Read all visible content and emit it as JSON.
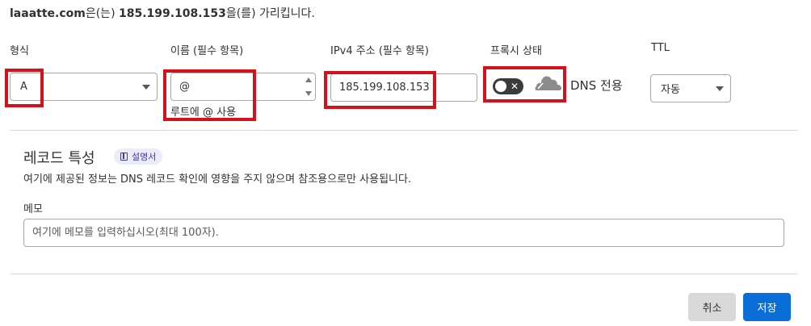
{
  "header": {
    "domain": "laaatte.com",
    "text_mid": "은(는) ",
    "ip": "185.199.108.153",
    "text_end": "을(를) 가리킵니다."
  },
  "columns": {
    "type_label": "형식",
    "name_label": "이름 (필수 항목)",
    "ipv4_label": "IPv4 주소 (필수 항목)",
    "proxy_label": "프록시 상태",
    "ttl_label": "TTL"
  },
  "type_select": {
    "value": "A"
  },
  "name_input": {
    "value": "@",
    "help": "루트에 @ 사용"
  },
  "ipv4_input": {
    "value": "185.199.108.153"
  },
  "proxy": {
    "toggle_on": false,
    "toggle_glyph": "✕",
    "status_text": "DNS 전용",
    "icon": "cloud-icon"
  },
  "ttl_select": {
    "value": "자동"
  },
  "record_attributes": {
    "title": "레코드 특성",
    "doc_badge": "설명서",
    "description": "여기에 제공된 정보는 DNS 레코드 확인에 영향을 주지 않으며 참조용으로만 사용됩니다.",
    "memo_label": "메모",
    "memo_placeholder": "여기에 메모를 입력하십시오(최대 100자)."
  },
  "actions": {
    "cancel_label": "취소",
    "save_label": "저장"
  },
  "colors": {
    "highlight": "#d4121b",
    "primary": "#0a6ed9",
    "badge_bg": "#ecebf9",
    "badge_text": "#3e3aa8"
  }
}
